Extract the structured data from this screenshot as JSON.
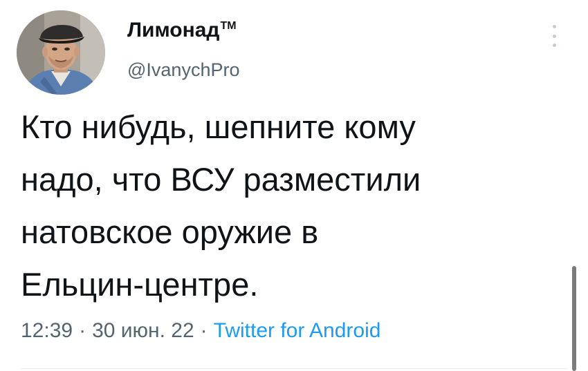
{
  "tweet": {
    "display_name": "Лимонад",
    "trademark": "TM",
    "handle": "@IvanychPro",
    "text_lines": [
      "Кто нибудь, шепните кому",
      "надо, что ВСУ разместили",
      "натовское оружие в",
      "Ельцин-центре."
    ],
    "time": "12:39",
    "separator": "·",
    "date": "30 июн. 22",
    "source": "Twitter for Android"
  },
  "icons": {
    "avatar": "user-avatar-photo",
    "more": "more-vertical-icon"
  },
  "colors": {
    "text": "#0f1419",
    "secondary": "#536471",
    "link": "#1d9bf0",
    "background": "#ffffff"
  }
}
